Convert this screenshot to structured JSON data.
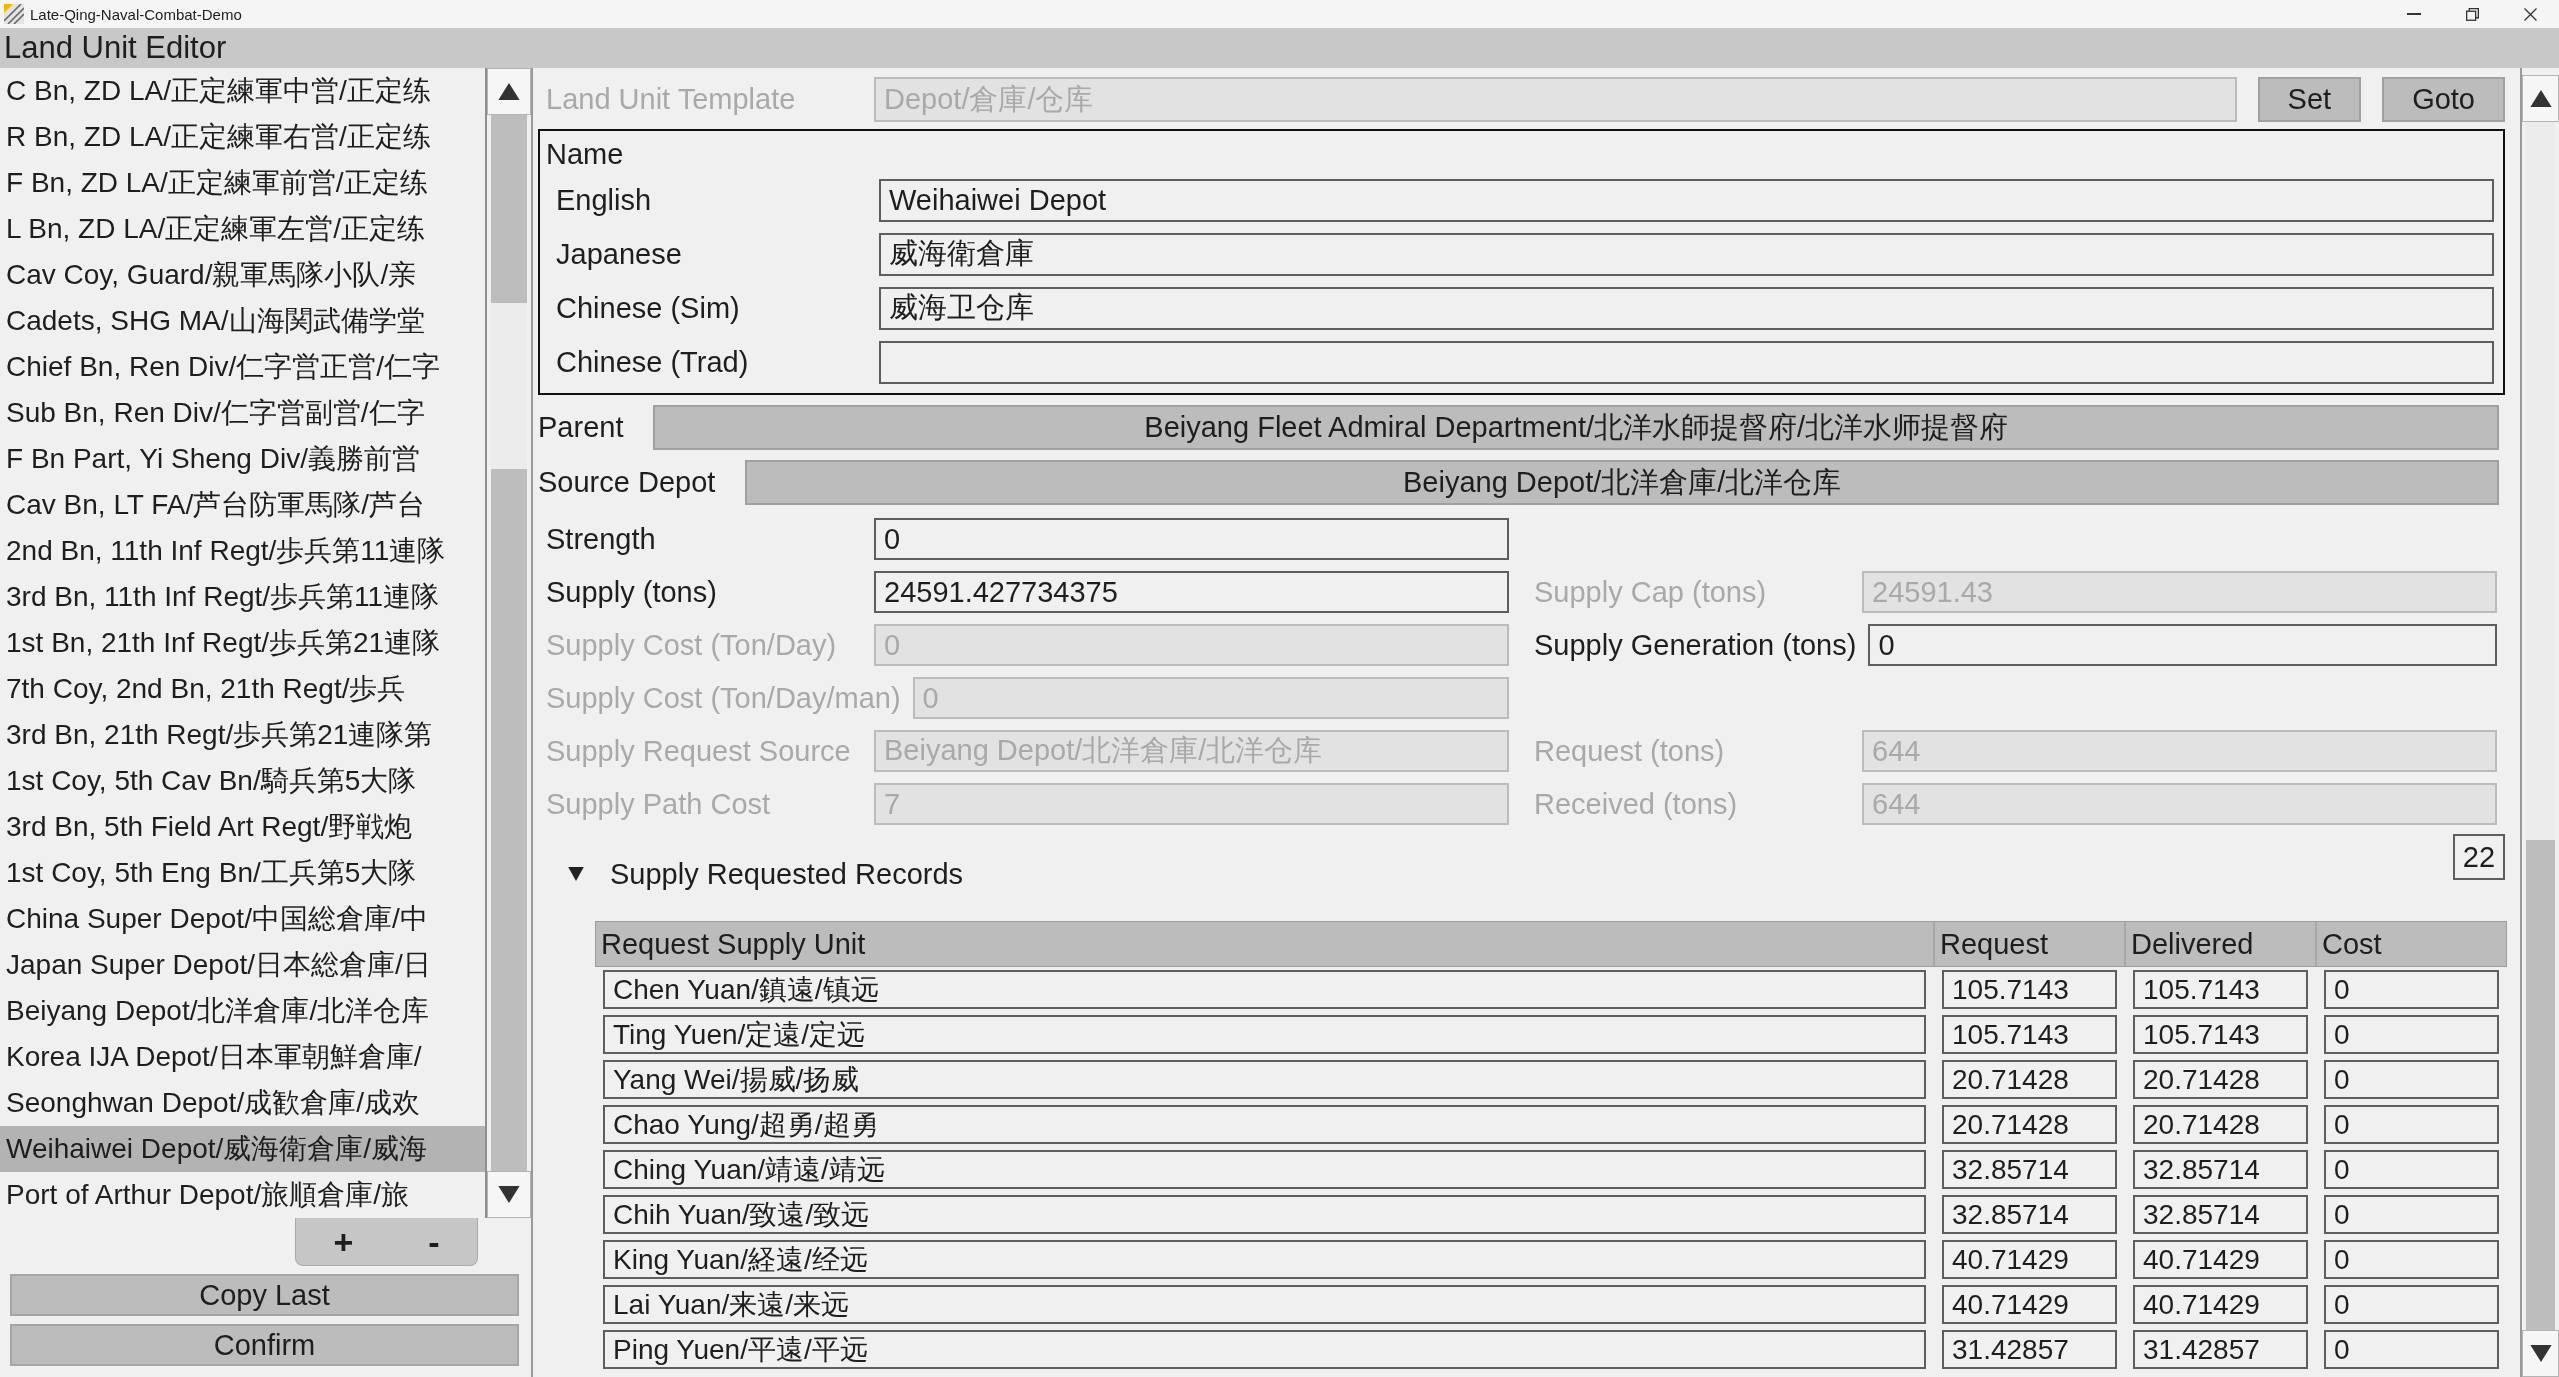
{
  "window": {
    "title": "Late-Qing-Naval-Combat-Demo"
  },
  "editor": {
    "title": "Land Unit Editor"
  },
  "unit_list": {
    "items": [
      {
        "label": "C Bn, ZD LA/正定練軍中営/正定练",
        "selected": false
      },
      {
        "label": "R Bn, ZD LA/正定練軍右営/正定练",
        "selected": false
      },
      {
        "label": "F Bn, ZD LA/正定練軍前営/正定练",
        "selected": false
      },
      {
        "label": "L Bn, ZD LA/正定練軍左営/正定练",
        "selected": false
      },
      {
        "label": "Cav Coy, Guard/親軍馬隊小队/亲",
        "selected": false
      },
      {
        "label": "Cadets, SHG MA/山海関武備学堂",
        "selected": false
      },
      {
        "label": "Chief Bn, Ren Div/仁字営正営/仁字",
        "selected": false
      },
      {
        "label": "Sub Bn, Ren Div/仁字営副営/仁字",
        "selected": false
      },
      {
        "label": "F Bn Part, Yi Sheng Div/義勝前営",
        "selected": false
      },
      {
        "label": "Cav Bn, LT FA/芦台防軍馬隊/芦台",
        "selected": false
      },
      {
        "label": "2nd Bn, 11th Inf Regt/歩兵第11連隊",
        "selected": false
      },
      {
        "label": "3rd Bn, 11th Inf Regt/歩兵第11連隊",
        "selected": false
      },
      {
        "label": "1st Bn, 21th Inf Regt/歩兵第21連隊",
        "selected": false
      },
      {
        "label": "7th Coy, 2nd Bn, 21th Regt/歩兵",
        "selected": false
      },
      {
        "label": "3rd Bn, 21th Regt/歩兵第21連隊第",
        "selected": false
      },
      {
        "label": "1st Coy, 5th Cav Bn/騎兵第5大隊",
        "selected": false
      },
      {
        "label": "3rd Bn, 5th Field Art Regt/野戦炮",
        "selected": false
      },
      {
        "label": "1st Coy, 5th Eng Bn/工兵第5大隊",
        "selected": false
      },
      {
        "label": "China Super Depot/中国総倉庫/中",
        "selected": false
      },
      {
        "label": "Japan Super Depot/日本総倉庫/日",
        "selected": false
      },
      {
        "label": "Beiyang Depot/北洋倉庫/北洋仓库",
        "selected": false
      },
      {
        "label": "Korea IJA Depot/日本軍朝鮮倉庫/",
        "selected": false
      },
      {
        "label": "Seonghwan Depot/成歓倉庫/成欢",
        "selected": false
      },
      {
        "label": "Weihaiwei Depot/威海衛倉庫/威海",
        "selected": true
      },
      {
        "label": "Port of Arthur Depot/旅順倉庫/旅",
        "selected": false
      }
    ],
    "buttons": [
      "+",
      "-"
    ]
  },
  "actions": [
    "Copy Last",
    "Confirm"
  ],
  "template": {
    "label": "Land Unit Template",
    "value": "Depot/倉庫/仓库",
    "disabled": true,
    "buttons": [
      "Set",
      "Goto"
    ]
  },
  "name_group": {
    "title": "Name",
    "fields": [
      {
        "label": "English",
        "value": "Weihaiwei Depot"
      },
      {
        "label": "Japanese",
        "value": "威海衛倉庫"
      },
      {
        "label": "Chinese (Sim)",
        "value": "威海卫仓库"
      },
      {
        "label": "Chinese (Trad)"
      }
    ]
  },
  "parent": {
    "label": "Parent",
    "value": "Beiyang Fleet Admiral Department/北洋水師提督府/北洋水师提督府"
  },
  "source_depot": {
    "label": "Source Depot",
    "value": "Beiyang Depot/北洋倉庫/北洋仓库"
  },
  "stats": [
    {
      "left": {
        "label": "Strength",
        "value": "0",
        "disabled": false
      }
    },
    {
      "left": {
        "label": "Supply (tons)",
        "value": "24591.427734375",
        "disabled": false
      },
      "right": {
        "label": "Supply Cap (tons)",
        "value": "24591.43",
        "disabled": true
      }
    },
    {
      "left": {
        "label": "Supply Cost (Ton/Day)",
        "value": "0",
        "disabled": true
      },
      "right": {
        "label": "Supply Generation (tons)",
        "value": "0",
        "disabled": false
      }
    },
    {
      "left": {
        "label": "Supply Cost (Ton/Day/man)",
        "value": "0",
        "disabled": true
      }
    },
    {
      "left": {
        "label": "Supply Request Source",
        "value": "Beiyang Depot/北洋倉庫/北洋仓库",
        "disabled": true
      },
      "right": {
        "label": "Request (tons)",
        "value": "644",
        "disabled": true
      }
    },
    {
      "left": {
        "label": "Supply Path Cost",
        "value": "7",
        "disabled": true
      },
      "right": {
        "label": "Received (tons)",
        "value": "644",
        "disabled": true
      }
    }
  ],
  "records": {
    "title": "Supply Requested Records",
    "expanded": true,
    "count": "22",
    "columns": [
      "Request Supply Unit",
      "Request",
      "Delivered",
      "Cost"
    ],
    "rows": [
      {
        "unit": "Chen Yuan/鎮遠/镇远",
        "request": "105.7143",
        "delivered": "105.7143",
        "cost": "0"
      },
      {
        "unit": "Ting Yuen/定遠/定远",
        "request": "105.7143",
        "delivered": "105.7143",
        "cost": "0"
      },
      {
        "unit": "Yang Wei/揚威/扬威",
        "request": "20.71428",
        "delivered": "20.71428",
        "cost": "0"
      },
      {
        "unit": "Chao Yung/超勇/超勇",
        "request": "20.71428",
        "delivered": "20.71428",
        "cost": "0"
      },
      {
        "unit": "Ching Yuan/靖遠/靖远",
        "request": "32.85714",
        "delivered": "32.85714",
        "cost": "0"
      },
      {
        "unit": "Chih Yuan/致遠/致远",
        "request": "32.85714",
        "delivered": "32.85714",
        "cost": "0"
      },
      {
        "unit": "King Yuan/経遠/经远",
        "request": "40.71429",
        "delivered": "40.71429",
        "cost": "0"
      },
      {
        "unit": "Lai Yuan/来遠/来远",
        "request": "40.71429",
        "delivered": "40.71429",
        "cost": "0"
      },
      {
        "unit": "Ping Yuen/平遠/平远",
        "request": "31.42857",
        "delivered": "31.42857",
        "cost": "0"
      }
    ]
  }
}
